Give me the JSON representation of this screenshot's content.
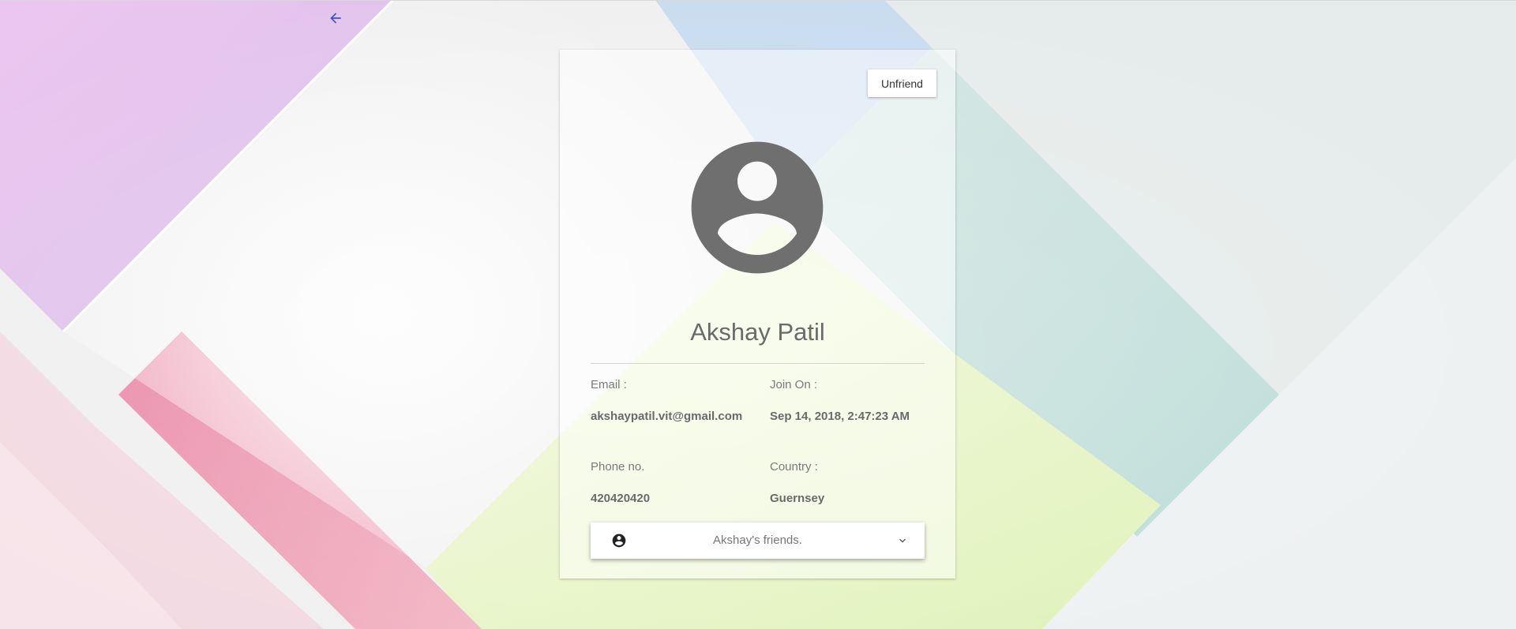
{
  "header": {
    "back_icon": "arrow-left-icon"
  },
  "profile": {
    "unfriend_label": "Unfriend",
    "avatar_icon": "account-circle-icon",
    "name": "Akshay Patil",
    "email_label": "Email :",
    "email_value": "akshaypatil.vit@gmail.com",
    "join_label": "Join On :",
    "join_value": "Sep 14, 2018, 2:47:23 AM",
    "phone_label": "Phone no.",
    "phone_value": "420420420",
    "country_label": "Country :",
    "country_value": "Guernsey"
  },
  "friends_panel": {
    "icon": "account-circle-icon",
    "label": "Akshay's friends.",
    "expand_icon": "chevron-down-icon"
  },
  "colors": {
    "accent": "#3f51b5",
    "avatar": "#6f6f6f"
  }
}
